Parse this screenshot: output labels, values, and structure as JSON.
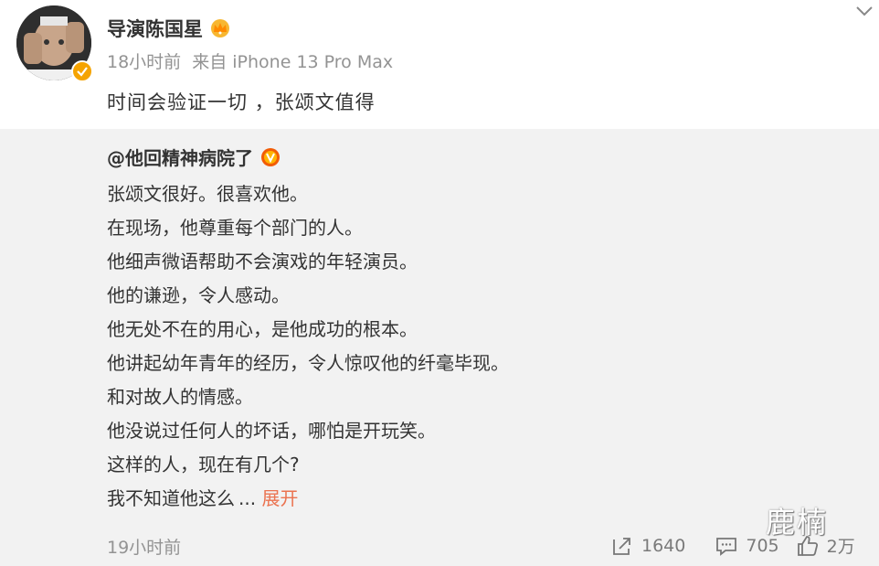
{
  "post": {
    "author": "导演陈国星",
    "author_icon": "crown-icon",
    "time": "18小时前",
    "source": "来自 iPhone 13 Pro Max",
    "text": "时间会验证一切 ，张颂文值得"
  },
  "repost": {
    "author": "@他回精神病院了",
    "lines": [
      "张颂文很好。很喜欢他。",
      "在现场，他尊重每个部门的人。",
      "他细声微语帮助不会演戏的年轻演员。",
      "他的谦逊，令人感动。",
      "他无处不在的用心，是他成功的根本。",
      "他讲起幼年青年的经历，令人惊叹他的纤毫毕现。",
      "和对故人的情感。",
      "他没说过任何人的坏话，哪怕是开玩笑。",
      "这样的人，现在有几个?"
    ],
    "last_line": "我不知道他这么",
    "ellipsis": "...",
    "expand_label": "展开",
    "time": "19小时前",
    "repost_count": "1640",
    "comment_count": "705",
    "like_count": "2万"
  },
  "watermark": "鹿楠",
  "colors": {
    "expand": "#eb7350",
    "meta": "#939393",
    "repost_bg": "#f2f2f2",
    "badge": "#f5a300"
  }
}
